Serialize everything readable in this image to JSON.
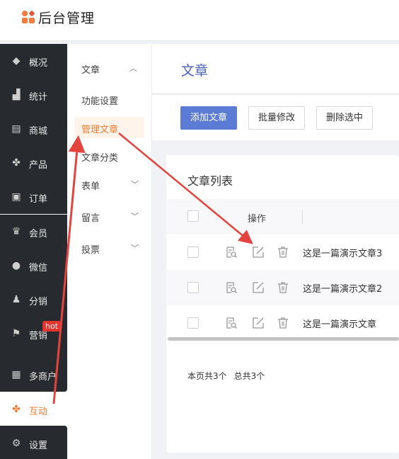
{
  "header": {
    "title": "后台管理"
  },
  "sidebar": {
    "items": [
      {
        "label": "概况",
        "icon": "layers-icon",
        "glyph": "◆"
      },
      {
        "label": "统计",
        "icon": "chart-icon",
        "glyph": "▟"
      },
      {
        "label": "商城",
        "icon": "shop-icon",
        "glyph": "▤"
      },
      {
        "label": "产品",
        "icon": "product-icon",
        "glyph": "✤"
      },
      {
        "label": "订单",
        "icon": "order-icon",
        "glyph": "▣"
      },
      {
        "label": "会员",
        "icon": "crown-icon",
        "glyph": "♛"
      },
      {
        "label": "微信",
        "icon": "wechat-icon",
        "glyph": "●"
      },
      {
        "label": "分销",
        "icon": "users-icon",
        "glyph": "♟"
      },
      {
        "label": "营销",
        "icon": "flag-icon",
        "glyph": "⚑"
      },
      {
        "label": "多商户",
        "icon": "store-icon",
        "glyph": "▦"
      },
      {
        "label": "互动",
        "icon": "interact-icon",
        "glyph": "✤"
      },
      {
        "label": "设置",
        "icon": "gear-icon",
        "glyph": "⚙"
      }
    ],
    "hot_badge": "hot"
  },
  "submenu": {
    "group": "文章",
    "items": [
      "功能设置",
      "管理文章",
      "文章分类"
    ],
    "groups": [
      "表单",
      "留言",
      "投票"
    ]
  },
  "main": {
    "page_title": "文章",
    "buttons": {
      "add": "添加文章",
      "batch_edit": "批量修改",
      "delete_selected": "删除选中"
    },
    "card_title": "文章列表",
    "column_ops": "操作",
    "rows": [
      "这是一篇演示文章3",
      "这是一篇演示文章2",
      "这是一篇演示文章"
    ],
    "footer": {
      "page_count": "本页共3个",
      "total_count": "总共3个"
    }
  },
  "colors": {
    "accent": "#f07c32",
    "primary": "#5b7bd5",
    "arrow": "#e4443e",
    "sidebar": "#272a2e"
  }
}
